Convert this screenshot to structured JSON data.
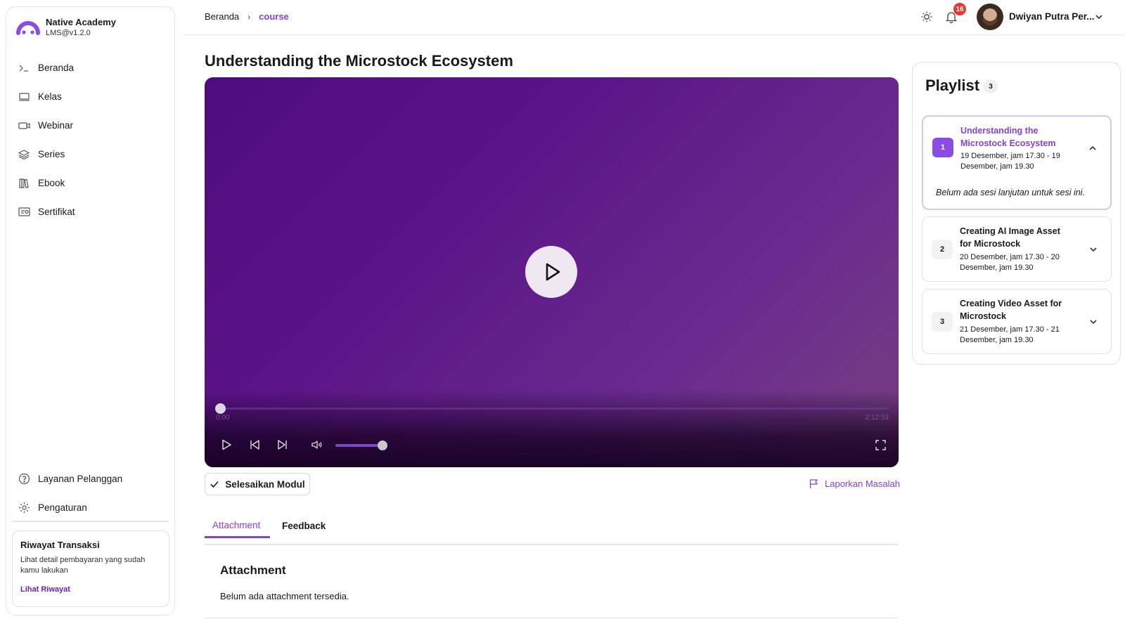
{
  "brand": {
    "name": "Native Academy",
    "version": "LMS@v1.2.0"
  },
  "sidebar": {
    "items": [
      {
        "label": "Beranda",
        "icon": "terminal-icon"
      },
      {
        "label": "Kelas",
        "icon": "laptop-icon"
      },
      {
        "label": "Webinar",
        "icon": "video-icon"
      },
      {
        "label": "Series",
        "icon": "layers-icon"
      },
      {
        "label": "Ebook",
        "icon": "books-icon"
      },
      {
        "label": "Sertifikat",
        "icon": "certificate-icon"
      }
    ],
    "bottom_items": [
      {
        "label": "Layanan Pelanggan",
        "icon": "help-circle-icon"
      },
      {
        "label": "Pengaturan",
        "icon": "gear-icon"
      }
    ],
    "riwayat": {
      "title": "Riwayat Transaksi",
      "desc": "Lihat detail pembayaran yang sudah kamu lakukan",
      "link": "Lihat Riwayat"
    }
  },
  "header": {
    "breadcrumb": {
      "home": "Beranda",
      "current": "course"
    },
    "notifications": "16",
    "user_name": "Dwiyan Putra Per..."
  },
  "main": {
    "title": "Understanding the Microstock Ecosystem",
    "video": {
      "current_time": "0:00",
      "duration": "2:12:53",
      "progress": 0,
      "volume": 1.0
    },
    "complete_button": "Selesaikan Modul",
    "report_link": "Laporkan Masalah",
    "tabs": [
      {
        "label": "Attachment"
      },
      {
        "label": "Feedback"
      }
    ],
    "attachment": {
      "title": "Attachment",
      "empty_text": "Belum ada attachment tersedia."
    }
  },
  "playlist": {
    "title": "Playlist",
    "count": "3",
    "items": [
      {
        "num": "1",
        "title": "Understanding the Microstock Ecosystem",
        "date": "19 Desember, jam 17.30 - 19 Desember, jam 19.30",
        "note": "Belum ada sesi lanjutan untuk sesi ini."
      },
      {
        "num": "2",
        "title": "Creating AI Image Asset for Microstock",
        "date": "20 Desember, jam 17.30 - 20 Desember, jam 19.30"
      },
      {
        "num": "3",
        "title": "Creating Video Asset for Microstock",
        "date": "21 Desember, jam 17.30 - 21 Desember, jam 19.30"
      }
    ]
  },
  "colors": {
    "accent": "#8a3fd6",
    "badge": "#e53935",
    "video_bg": "#5b1487"
  }
}
